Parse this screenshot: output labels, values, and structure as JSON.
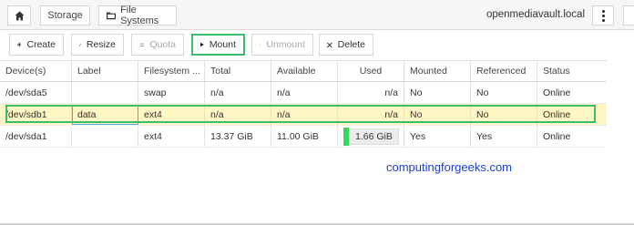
{
  "topbar": {
    "breadcrumbs": [
      {
        "label": "",
        "icon": "home-icon"
      },
      {
        "label": "Storage"
      },
      {
        "label": "File Systems",
        "icon": "folder-icon"
      }
    ],
    "hostname": "openmediavault.local",
    "menu_icon": "vertical-dots-icon"
  },
  "toolbar": {
    "create_label": "Create",
    "resize_label": "Resize",
    "quota_label": "Quota",
    "mount_label": "Mount",
    "unmount_label": "Unmount",
    "delete_label": "Delete"
  },
  "table": {
    "columns": [
      "Device(s)",
      "Label",
      "Filesystem ...",
      "Total",
      "Available",
      "Used",
      "Mounted",
      "Referenced",
      "Status"
    ],
    "rows": [
      {
        "device": "/dev/sda5",
        "label": "",
        "filesystem": "swap",
        "total": "n/a",
        "available": "n/a",
        "used": "n/a",
        "mounted": "No",
        "referenced": "No",
        "status": "Online"
      },
      {
        "device": "/dev/sdb1",
        "label": "data",
        "filesystem": "ext4",
        "total": "n/a",
        "available": "n/a",
        "used": "n/a",
        "mounted": "No",
        "referenced": "No",
        "status": "Online"
      },
      {
        "device": "/dev/sda1",
        "label": "",
        "filesystem": "ext4",
        "total": "13.37 GiB",
        "available": "11.00 GiB",
        "used": "1.66 GiB",
        "used_fraction": 0.12,
        "mounted": "Yes",
        "referenced": "Yes",
        "status": "Online"
      }
    ]
  },
  "colors": {
    "highlight_outline": "#3cbd6d",
    "selected_row": "#fff6c4",
    "usage_bar": "#3bd45c",
    "watermark": "#1d3fd0"
  },
  "watermark": "computingforgeeks.com"
}
